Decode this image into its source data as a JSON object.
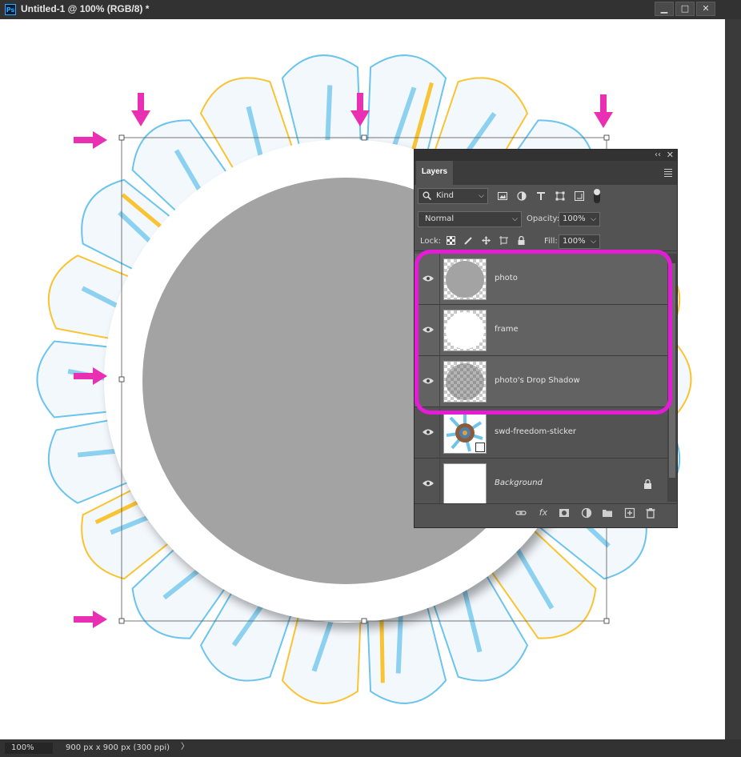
{
  "window": {
    "title": "Untitled-1 @ 100% (RGB/8) *",
    "app_icon": "photoshop-icon",
    "controls": [
      "minimize-icon",
      "maximize-icon",
      "close-icon"
    ]
  },
  "status": {
    "zoom": "100%",
    "doc_size": "900 px x 900 px (300 ppi)"
  },
  "layers_panel": {
    "tab_label": "Layers",
    "filter_kind": "Kind",
    "blend_mode": "Normal",
    "opacity_label": "Opacity:",
    "opacity_value": "100%",
    "lock_label": "Lock:",
    "fill_label": "Fill:",
    "fill_value": "100%",
    "layers": [
      {
        "name": "photo",
        "visible": true,
        "thumb": "gray-circle"
      },
      {
        "name": "frame",
        "visible": true,
        "thumb": "white-circle"
      },
      {
        "name": "photo's Drop Shadow",
        "visible": true,
        "thumb": "shadow-circle"
      },
      {
        "name": "swd-freedom-sticker",
        "visible": true,
        "thumb": "sunflower-sticker"
      },
      {
        "name": "Background",
        "visible": true,
        "thumb": "white",
        "locked": true
      }
    ],
    "footer_icons": [
      "link-icon",
      "fx-icon",
      "mask-icon",
      "adjustment-icon",
      "folder-icon",
      "new-layer-icon",
      "trash-icon"
    ]
  },
  "colors": {
    "annotation_arrow": "#e92fb2",
    "highlight": "#e51bd8",
    "petal_blue": "#6cc4ec",
    "petal_yellow": "#f9c433",
    "frame_gray": "#a3a3a3"
  }
}
